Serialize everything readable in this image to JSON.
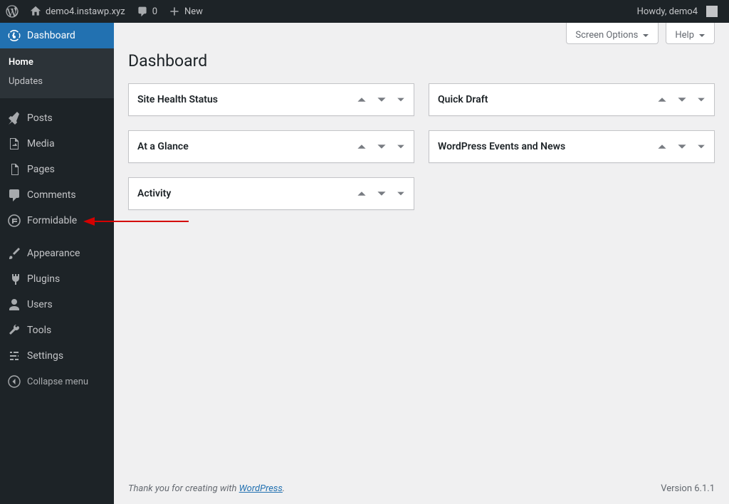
{
  "adminbar": {
    "site_name": "demo4.instawp.xyz",
    "comments_count": "0",
    "new_label": "New",
    "greeting": "Howdy, demo4"
  },
  "sidebar": {
    "items": [
      {
        "label": "Dashboard"
      },
      {
        "label": "Posts"
      },
      {
        "label": "Media"
      },
      {
        "label": "Pages"
      },
      {
        "label": "Comments"
      },
      {
        "label": "Formidable"
      },
      {
        "label": "Appearance"
      },
      {
        "label": "Plugins"
      },
      {
        "label": "Users"
      },
      {
        "label": "Tools"
      },
      {
        "label": "Settings"
      }
    ],
    "submenu": [
      {
        "label": "Home"
      },
      {
        "label": "Updates"
      }
    ],
    "collapse_label": "Collapse menu"
  },
  "top_actions": {
    "screen_options": "Screen Options",
    "help": "Help"
  },
  "page_title": "Dashboard",
  "postboxes": {
    "col1": [
      {
        "title": "Site Health Status"
      },
      {
        "title": "At a Glance"
      },
      {
        "title": "Activity"
      }
    ],
    "col2": [
      {
        "title": "Quick Draft"
      },
      {
        "title": "WordPress Events and News"
      }
    ]
  },
  "footer": {
    "thank_prefix": "Thank you for creating with ",
    "thank_link": "WordPress",
    "thank_suffix": ".",
    "version": "Version 6.1.1"
  }
}
